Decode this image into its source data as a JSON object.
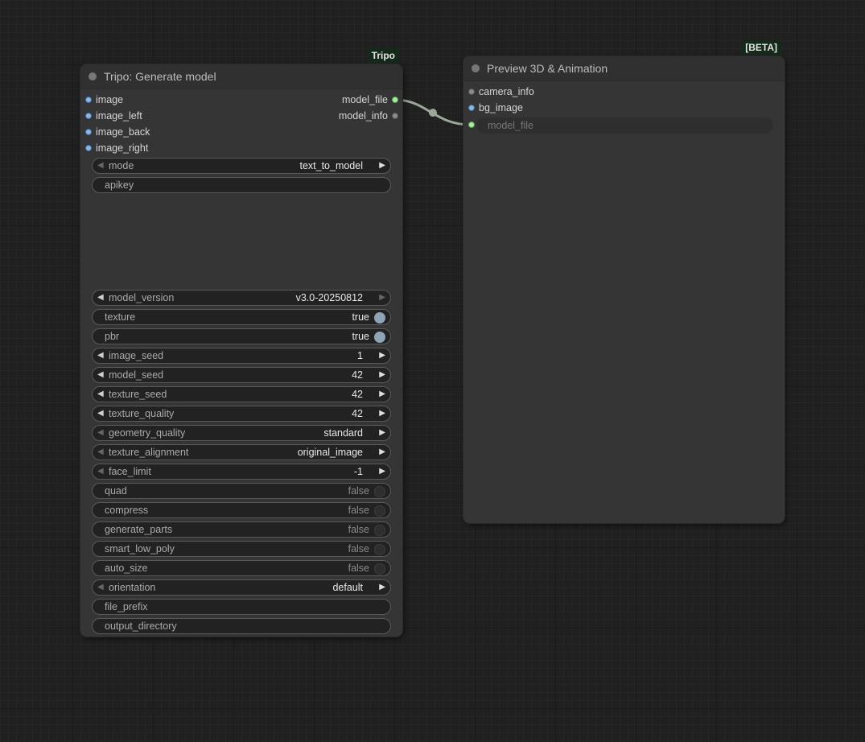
{
  "tripo_node": {
    "badge": "Tripo",
    "title": "Tripo: Generate model",
    "inputs": [
      "image",
      "image_left",
      "image_back",
      "image_right"
    ],
    "outputs": [
      "model_file",
      "model_info"
    ],
    "widgets": {
      "mode": {
        "name": "mode",
        "value": "text_to_model"
      },
      "apikey": {
        "name": "apikey"
      },
      "model_version": {
        "name": "model_version",
        "value": "v3.0-20250812"
      },
      "texture": {
        "name": "texture",
        "value": "true"
      },
      "pbr": {
        "name": "pbr",
        "value": "true"
      },
      "image_seed": {
        "name": "image_seed",
        "value": "1"
      },
      "model_seed": {
        "name": "model_seed",
        "value": "42"
      },
      "texture_seed": {
        "name": "texture_seed",
        "value": "42"
      },
      "texture_quality": {
        "name": "texture_quality",
        "value": "42"
      },
      "geometry_quality": {
        "name": "geometry_quality",
        "value": "standard"
      },
      "texture_alignment": {
        "name": "texture_alignment",
        "value": "original_image"
      },
      "face_limit": {
        "name": "face_limit",
        "value": "-1"
      },
      "quad": {
        "name": "quad",
        "value": "false"
      },
      "compress": {
        "name": "compress",
        "value": "false"
      },
      "generate_parts": {
        "name": "generate_parts",
        "value": "false"
      },
      "smart_low_poly": {
        "name": "smart_low_poly",
        "value": "false"
      },
      "auto_size": {
        "name": "auto_size",
        "value": "false"
      },
      "orientation": {
        "name": "orientation",
        "value": "default"
      },
      "file_prefix": {
        "name": "file_prefix"
      },
      "output_directory": {
        "name": "output_directory"
      }
    }
  },
  "preview_node": {
    "badge": "[BETA]",
    "title": "Preview 3D & Animation",
    "inputs": [
      "camera_info",
      "bg_image",
      "model_file"
    ],
    "model_file_field": "model_file"
  },
  "colors": {
    "canvas": "#202020",
    "node_body": "#353535",
    "node_title": "#303030",
    "badge_bg": "#122a17",
    "link": "#9aa89a",
    "image_slot": "#8ab8e8",
    "model_slot": "#a8f0a0"
  }
}
